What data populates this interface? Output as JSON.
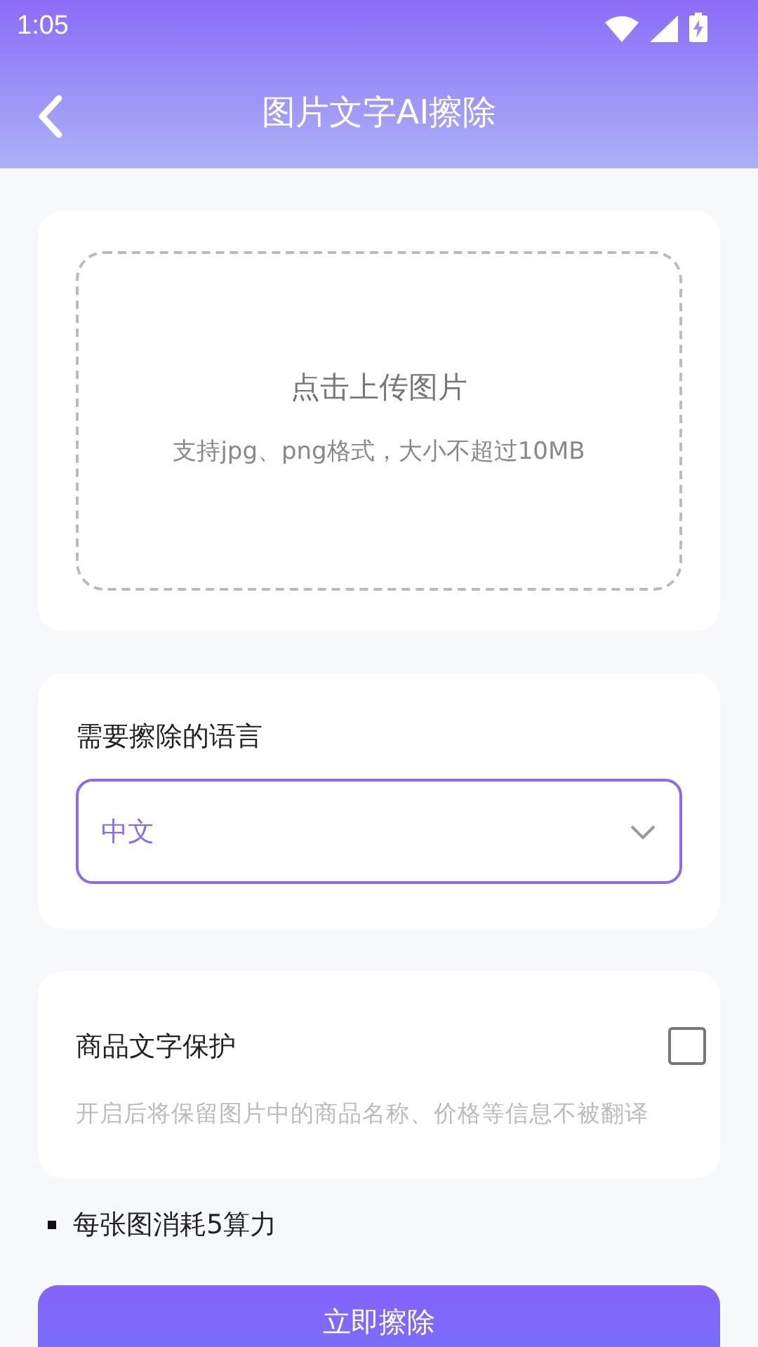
{
  "status_bar": {
    "time": "1:05"
  },
  "header": {
    "title": "图片文字AI擦除"
  },
  "upload": {
    "title": "点击上传图片",
    "hint": "支持jpg、png格式，大小不超过10MB"
  },
  "language": {
    "label": "需要擦除的语言",
    "value": "中文"
  },
  "protection": {
    "label": "商品文字保护",
    "checked": false,
    "description": "开启后将保留图片中的商品名称、价格等信息不被翻译"
  },
  "note": "每张图消耗5算力",
  "submit_button": "立即擦除"
}
